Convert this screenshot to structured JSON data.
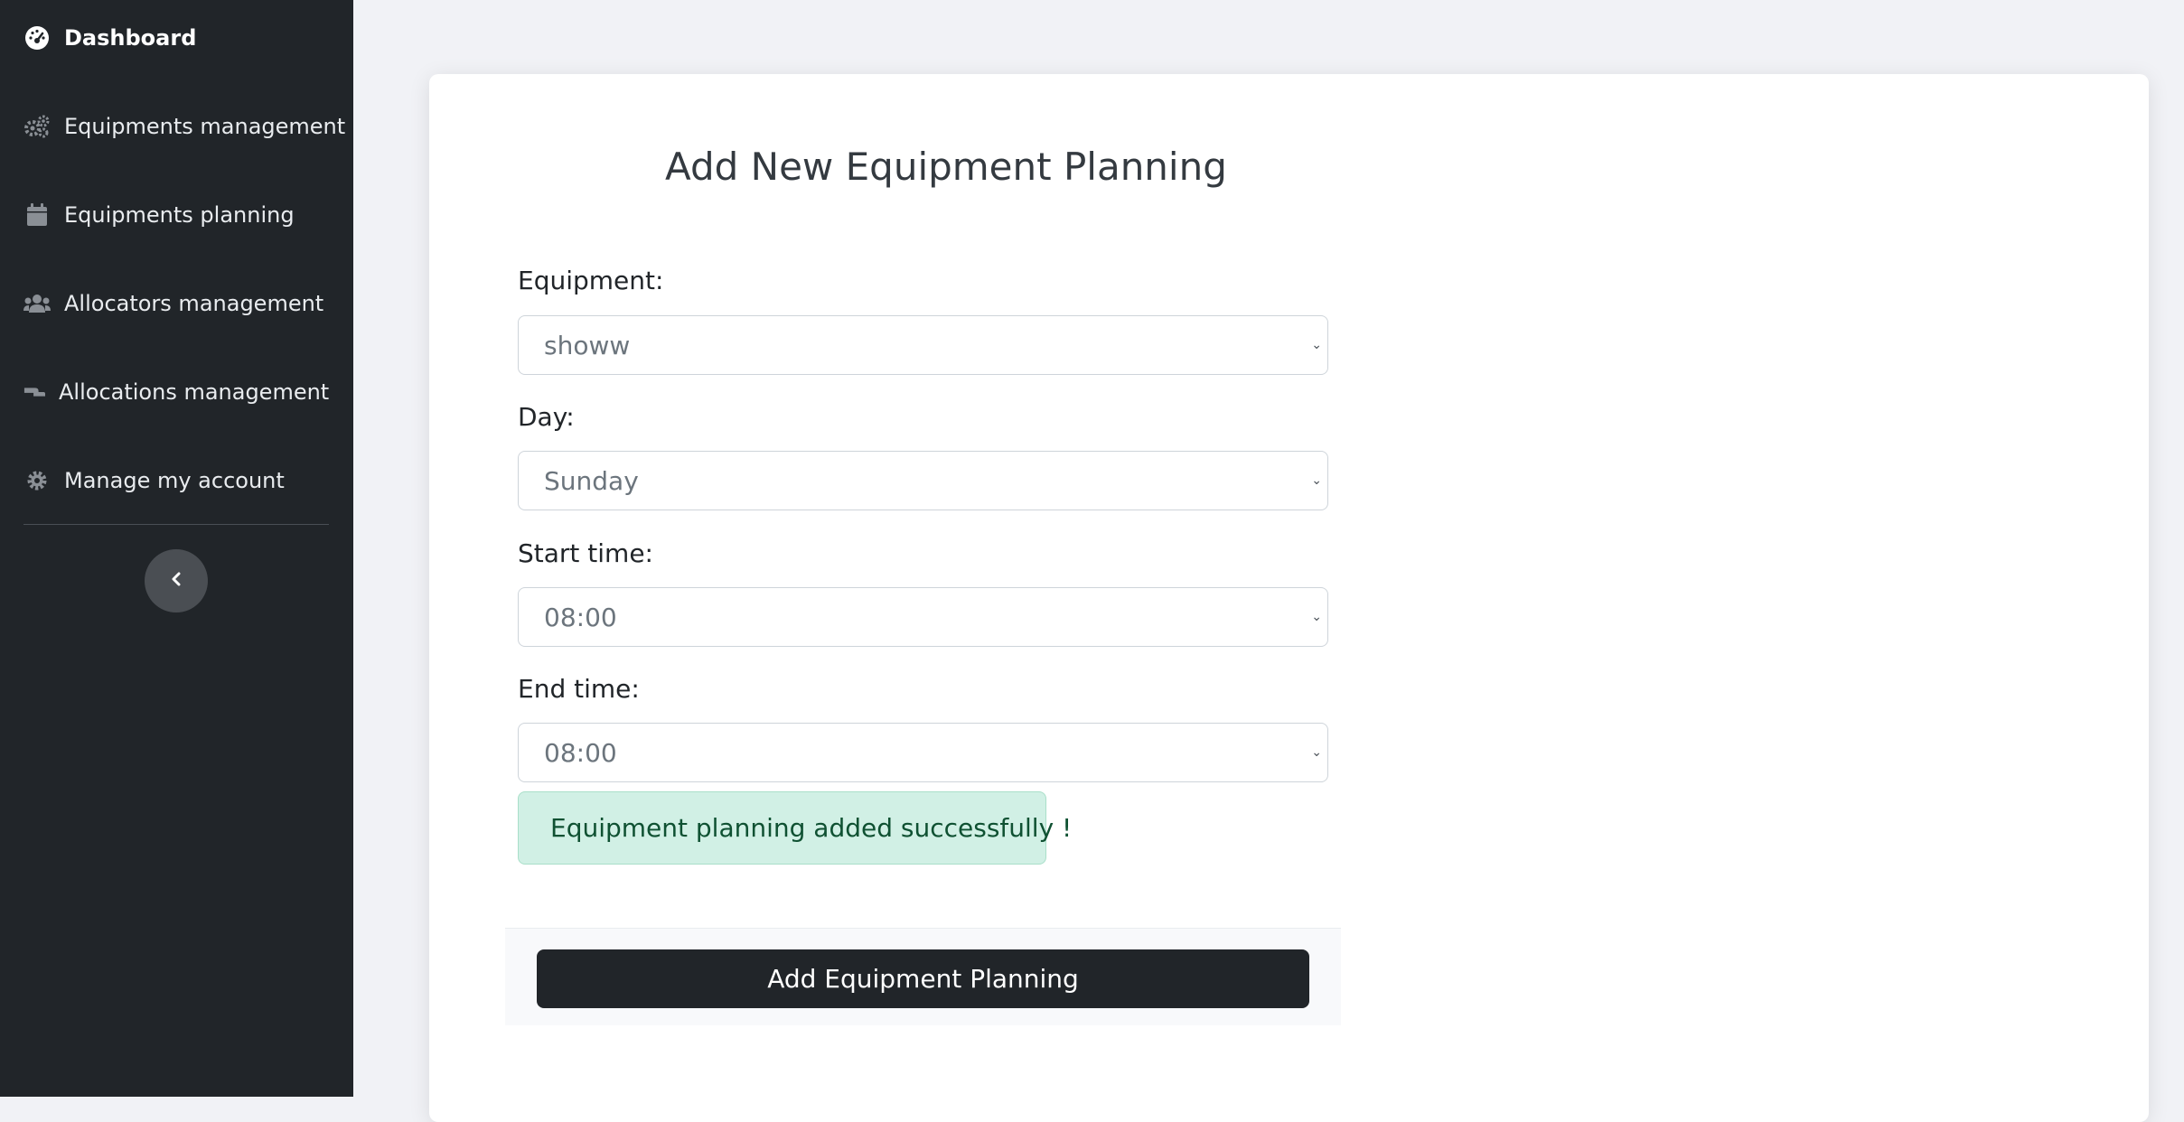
{
  "sidebar": {
    "items": [
      {
        "label": "Dashboard",
        "icon": "gauge-icon",
        "active": true
      },
      {
        "label": "Equipments management",
        "icon": "gears-icon",
        "active": false
      },
      {
        "label": "Equipments planning",
        "icon": "calendar-icon",
        "active": false
      },
      {
        "label": "Allocators management",
        "icon": "users-icon",
        "active": false
      },
      {
        "label": "Allocations management",
        "icon": "hand-holding-icon",
        "active": false
      },
      {
        "label": "Manage my account",
        "icon": "gear-icon",
        "active": false
      }
    ],
    "collapse_icon": "chevron-left-icon"
  },
  "form": {
    "title": "Add New Equipment Planning",
    "fields": {
      "equipment": {
        "label": "Equipment:",
        "value": "showw"
      },
      "day": {
        "label": "Day:",
        "value": "Sunday"
      },
      "start_time": {
        "label": "Start time:",
        "value": "08:00"
      },
      "end_time": {
        "label": "End time:",
        "value": "08:00"
      }
    },
    "success_message": "Equipment planning added successfully !",
    "submit_label": "Add Equipment Planning"
  },
  "colors": {
    "sidebar_bg": "#212529",
    "page_bg": "#f1f2f6",
    "alert_bg": "#d1f0e5",
    "alert_text": "#0f5132",
    "button_bg": "#212529"
  }
}
